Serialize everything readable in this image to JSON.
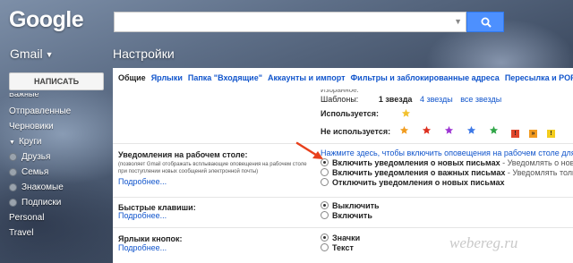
{
  "header": {
    "logo": "Google",
    "search": {
      "placeholder": "",
      "value": ""
    },
    "search_arrow_icon": "chevron-down-icon",
    "search_button_icon": "search-icon"
  },
  "nav": {
    "gmail_label": "Gmail",
    "page_title": "Настройки",
    "compose_label": "НАПИСАТЬ"
  },
  "sidebar": {
    "items": [
      {
        "label": "Важные",
        "type": "cut"
      },
      {
        "label": "Отправленные",
        "type": "plain"
      },
      {
        "label": "Черновики",
        "type": "plain"
      },
      {
        "label": "Круги",
        "type": "group"
      },
      {
        "label": "Друзья",
        "type": "circle"
      },
      {
        "label": "Семья",
        "type": "circle"
      },
      {
        "label": "Знакомые",
        "type": "circle"
      },
      {
        "label": "Подписки",
        "type": "circle"
      },
      {
        "label": "Personal",
        "type": "plain"
      },
      {
        "label": "Travel",
        "type": "plain"
      }
    ]
  },
  "tabs": [
    {
      "label": "Общие",
      "active": true
    },
    {
      "label": "Ярлыки",
      "active": false
    },
    {
      "label": "Папка \"Входящие\"",
      "active": false
    },
    {
      "label": "Аккаунты и импорт",
      "active": false
    },
    {
      "label": "Фильтры и заблокированные адреса",
      "active": false
    },
    {
      "label": "Пересылка и POP",
      "active": false
    }
  ],
  "stars": {
    "top_cut": "Избранное:",
    "presets_label": "Шаблоны:",
    "preset_one": "1 звезда",
    "preset_four": "4 звезды",
    "preset_all": "все звезды",
    "used_label": "Используется:",
    "used_icons": [
      {
        "icon": "star-icon",
        "color": "#f2c12e"
      }
    ],
    "unused_label": "Не используется:",
    "unused_icons": [
      {
        "icon": "star-icon",
        "color": "#f19c1f",
        "shape": "star"
      },
      {
        "icon": "star-icon",
        "color": "#dd2f1f",
        "shape": "star"
      },
      {
        "icon": "star-icon",
        "color": "#9d35d3",
        "shape": "star"
      },
      {
        "icon": "star-icon",
        "color": "#3d78e6",
        "shape": "star"
      },
      {
        "icon": "star-icon",
        "color": "#2fa547",
        "shape": "star"
      },
      {
        "icon": "exclamation-icon",
        "color": "#e0452b",
        "shape": "box",
        "glyph": "!"
      },
      {
        "icon": "chevrons-icon",
        "color": "#f29a1f",
        "shape": "box",
        "glyph": "»"
      },
      {
        "icon": "exclamation-icon",
        "color": "#f3cc1e",
        "shape": "box",
        "glyph": "!"
      }
    ]
  },
  "settings": {
    "desktop_notifications": {
      "label": "Уведомления на рабочем столе:",
      "description": "(позволяет Gmail отображать всплывающие оповещения на рабочем столе при поступлении новых сообщений электронной почты)",
      "more": "Подробнее...",
      "enable_link": "Нажмите здесь, чтобы включить оповещения на рабочем столе для Gmail",
      "options": [
        {
          "label": "Включить уведомления о новых письмах",
          "desc": " - Уведомлять о новых письмах",
          "checked": true
        },
        {
          "label": "Включить уведомления о важных письмах",
          "desc": " - Уведомлять только о важных",
          "checked": false
        },
        {
          "label": "Отключить уведомления о новых письмах",
          "desc": "",
          "checked": false
        }
      ]
    },
    "shortcuts": {
      "label": "Быстрые клавиши:",
      "more": "Подробнее...",
      "options": [
        {
          "label": "Выключить",
          "checked": true
        },
        {
          "label": "Включить",
          "checked": false
        }
      ]
    },
    "button_labels": {
      "label": "Ярлыки кнопок:",
      "more": "Подробнее...",
      "options": [
        {
          "label": "Значки",
          "checked": true
        },
        {
          "label": "Текст",
          "checked": false
        }
      ]
    }
  },
  "watermark": "webereg.ru",
  "colors": {
    "link": "#1155cc",
    "search_button": "#4d90fe",
    "arrow": "#e8401c"
  }
}
